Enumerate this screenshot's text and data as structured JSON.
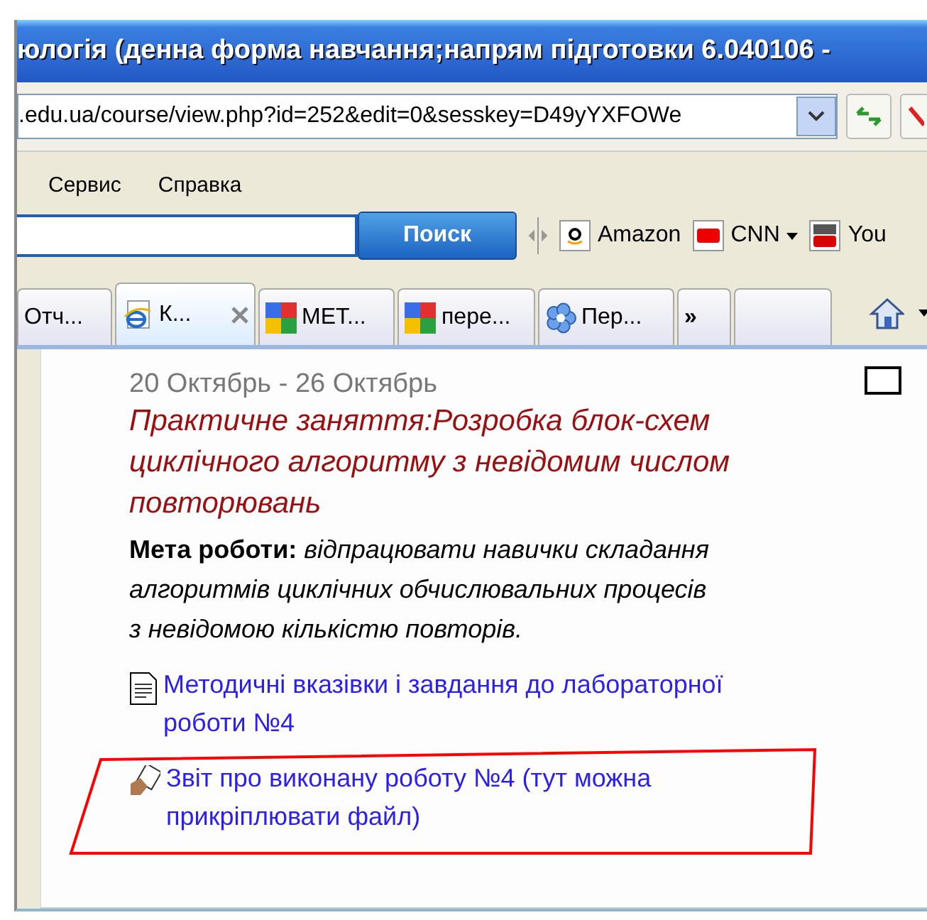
{
  "window": {
    "title": "юлогія (денна форма навчання;напрям підготовки 6.040106 -"
  },
  "address_bar": {
    "value": ".edu.ua/course/view.php?id=252&edit=0&sesskey=D49yYXFOWe"
  },
  "menu": [
    {
      "label": "Сервис"
    },
    {
      "label": "Справка"
    }
  ],
  "search_toolbar": {
    "button": "Поиск",
    "links": [
      {
        "label": "Amazon",
        "kind": "amazon",
        "dropdown": false
      },
      {
        "label": "CNN",
        "kind": "cnn",
        "dropdown": true
      },
      {
        "label": "You",
        "kind": "youtube",
        "dropdown": false
      }
    ]
  },
  "tabs": [
    {
      "label": "Отч...",
      "kind": "plain",
      "selected": false
    },
    {
      "label": "К...",
      "kind": "ie",
      "selected": true
    },
    {
      "label": "МЕТ...",
      "kind": "google",
      "selected": false
    },
    {
      "label": "пере...",
      "kind": "google",
      "selected": false
    },
    {
      "label": "Пер...",
      "kind": "flower",
      "selected": false
    },
    {
      "label": "»",
      "kind": "more",
      "selected": false
    },
    {
      "kind": "blank",
      "selected": false
    }
  ],
  "content": {
    "dates": "20 Октябрь - 26 Октябрь",
    "checked": false,
    "topic": "Практичне заняття:Розробка блок-схем циклічного алгоритму з невідомим числом повторювань",
    "goal": "**Мета роботи:** *відпрацювати навички складання алгоритмів циклічних обчислювальних процесів з невідомою кількістю повторів.*",
    "resources": [
      {
        "kind": "document",
        "label": "Методичні вказівки і завдання до лабораторної роботи №4",
        "highlighted": false
      },
      {
        "kind": "assignment",
        "label": "Звіт про виконану роботу №4 (тут можна прикріплювати файл)",
        "highlighted": true
      }
    ]
  }
}
